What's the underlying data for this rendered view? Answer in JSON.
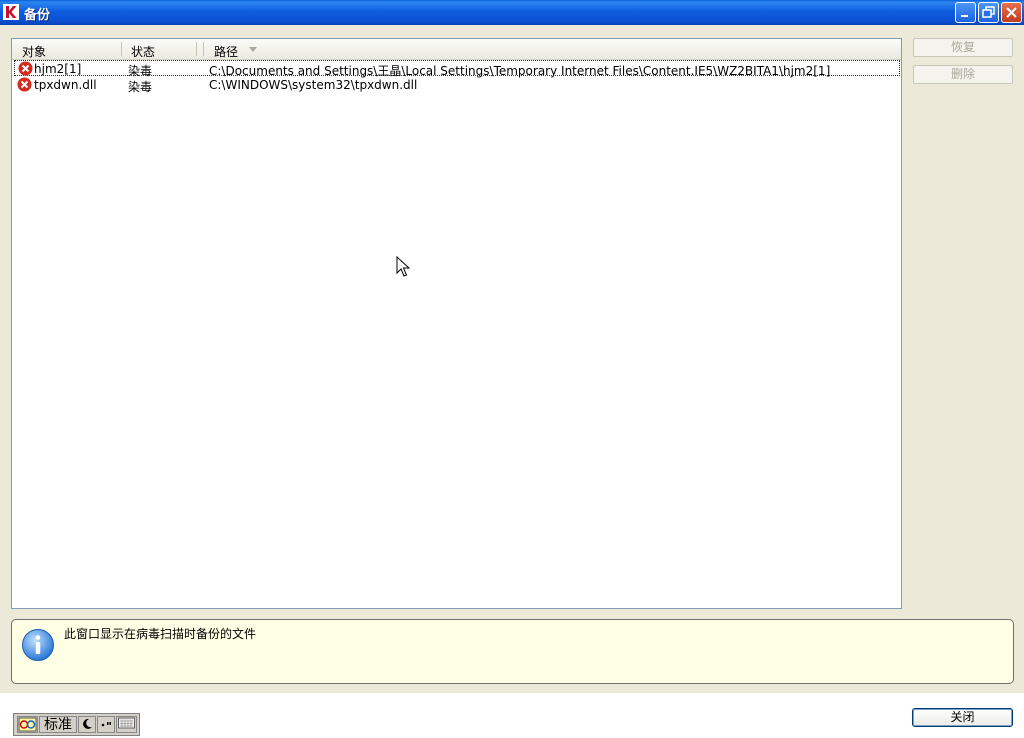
{
  "window": {
    "title": "备份",
    "app_icon": "kaspersky-k-icon",
    "controls": [
      "minimize-icon",
      "restore-icon",
      "close-icon"
    ]
  },
  "list": {
    "columns": [
      {
        "label": "对象"
      },
      {
        "label": "状态"
      },
      {
        "label": "路径",
        "sorted": true
      }
    ],
    "rows": [
      {
        "icon": "infected-icon",
        "object": "hjm2[1]",
        "status": "染毒",
        "path": "C:\\Documents and Settings\\王晶\\Local Settings\\Temporary Internet Files\\Content.IE5\\WZ2BITA1\\hjm2[1]"
      },
      {
        "icon": "infected-icon",
        "object": "tpxdwn.dll",
        "status": "染毒",
        "path": "C:\\WINDOWS\\system32\\tpxdwn.dll"
      }
    ]
  },
  "side_buttons": {
    "restore_label": "恢复",
    "delete_label": "删除"
  },
  "info": {
    "icon": "info-icon",
    "text": "此窗口显示在病毒扫描时备份的文件"
  },
  "ime": {
    "mode_label": "标准"
  },
  "footer": {
    "close_label": "关闭"
  },
  "colors": {
    "titlebar": "#0a4fd0",
    "dialog_bg": "#ece9d8",
    "info_bg": "#ffffe6",
    "infected_red": "#d42b1e"
  }
}
